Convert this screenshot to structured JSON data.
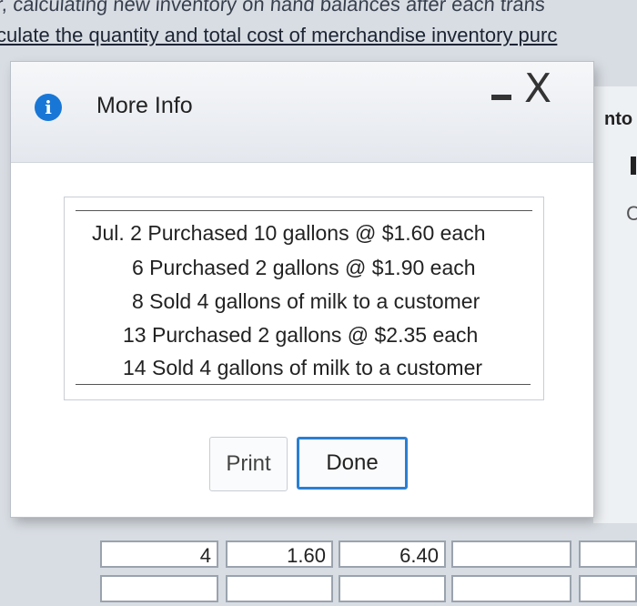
{
  "background": {
    "line1": "r, calculating new inventory on hand balances after each trans",
    "line2": "culate the quantity and total cost of merchandise inventory purc",
    "right_text": "nto",
    "right_c": "C"
  },
  "dialog": {
    "title": "More Info",
    "info_icon": "i",
    "close_glyph": "X",
    "transactions": [
      "Jul. 2 Purchased 10 gallons @ $1.60 each",
      "6 Purchased 2 gallons @ $1.90 each",
      "8 Sold 4 gallons of milk to a customer",
      "13 Purchased 2 gallons @ $2.35 each",
      "14 Sold 4 gallons of milk to a customer"
    ],
    "print_label": "Print",
    "done_label": "Done"
  },
  "table": {
    "row1": [
      "4",
      "1.60",
      "6.40"
    ]
  }
}
